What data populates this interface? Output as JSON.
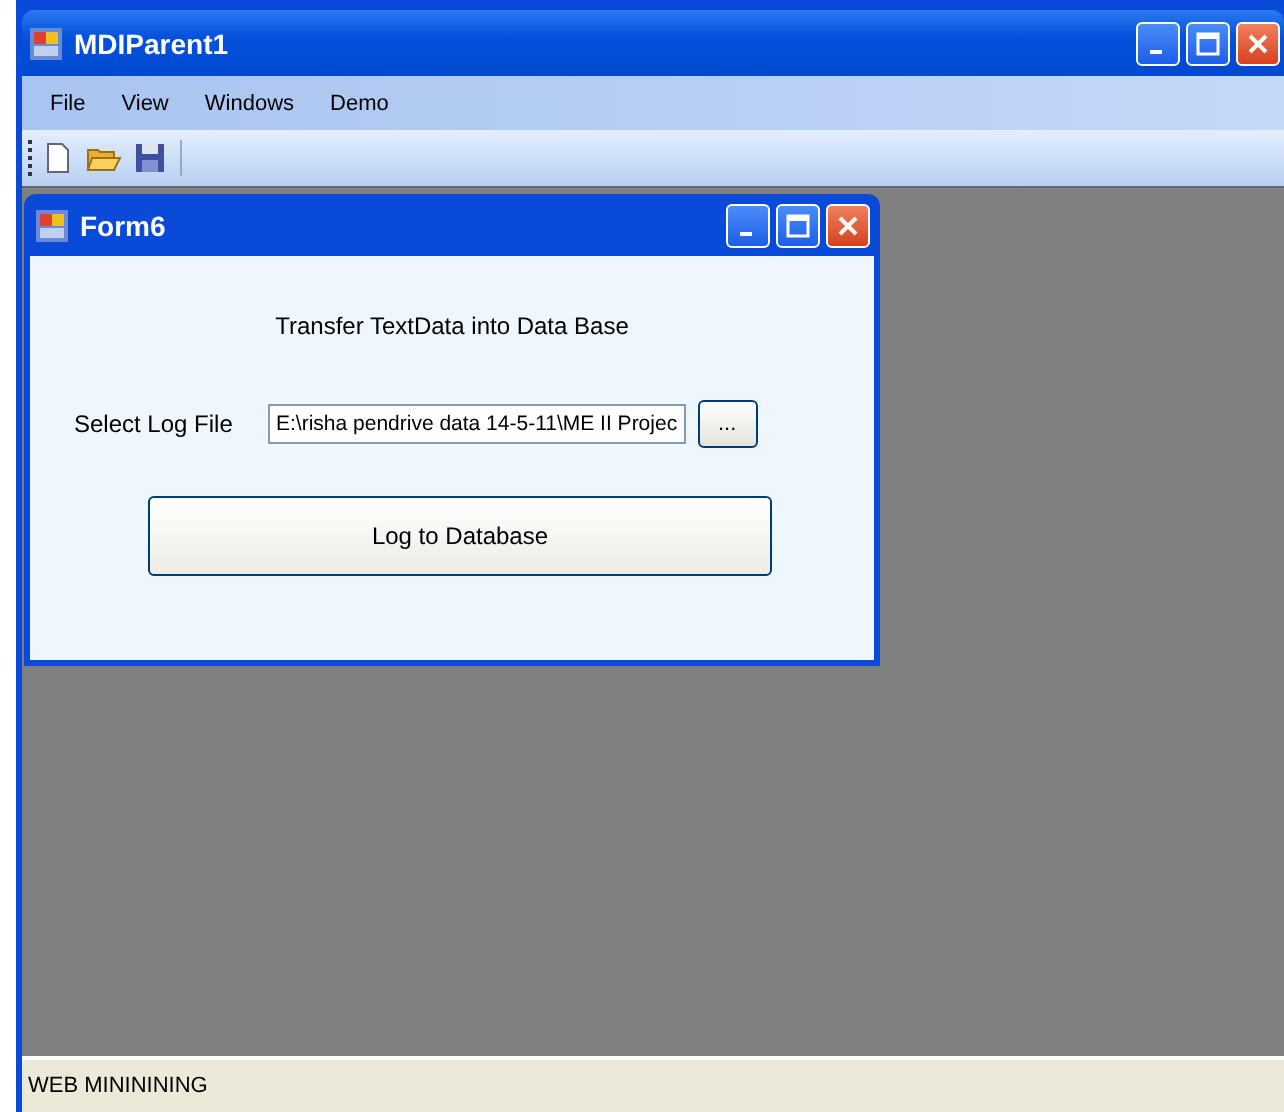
{
  "window": {
    "title": "MDIParent1"
  },
  "menu": [
    "File",
    "View",
    "Windows",
    "Demo"
  ],
  "child_window": {
    "title": "Form6",
    "heading": "Transfer TextData into Data Base",
    "file_label": "Select Log File",
    "file_value": "E:\\risha pendrive data 14-5-11\\ME II Projec",
    "browse_button": "...",
    "action_button": "Log to Database"
  },
  "status_bar": "WEB MINININING"
}
